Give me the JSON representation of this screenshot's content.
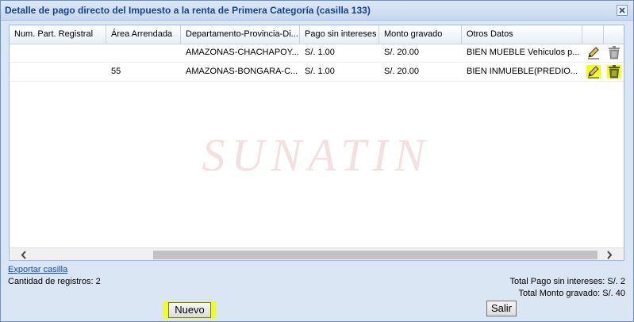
{
  "window": {
    "title": "Detalle de pago directo del Impuesto a la renta de Primera Categoría (casilla 133)",
    "close_glyph": "×"
  },
  "grid": {
    "columns": [
      "Num. Part. Registral",
      "Área Arrendada",
      "Departamento-Provincia-Di...",
      "Pago sin intereses",
      "Monto gravado",
      "Otros Datos"
    ],
    "rows": [
      {
        "num_part": "",
        "area": "",
        "ubicacion": "AMAZONAS-CHACHAPOY...",
        "pago": "S/. 1.00",
        "monto": "S/. 20.00",
        "otros": "BIEN MUEBLE Vehiculos p...",
        "highlighted": false
      },
      {
        "num_part": "",
        "area": "55",
        "ubicacion": "AMAZONAS-BONGARA-C...",
        "pago": "S/. 1.00",
        "monto": "S/. 20.00",
        "otros": "BIEN INMUEBLE(PREDIO...",
        "highlighted": true
      }
    ],
    "watermark": "SUNATIN",
    "icons": {
      "edit": "pencil-icon",
      "delete": "trash-icon"
    }
  },
  "footer": {
    "export_link": "Exportar casilla",
    "record_count": "Cantidad de registros: 2",
    "total_pago": "Total Pago sin intereses: S/. 2",
    "total_monto": "Total Monto gravado: S/. 40"
  },
  "buttons": {
    "nuevo": "Nuevo",
    "salir": "Salir"
  },
  "colors": {
    "highlight": "#f0ff1c",
    "title_text": "#15428b",
    "link": "#0b46c3"
  }
}
